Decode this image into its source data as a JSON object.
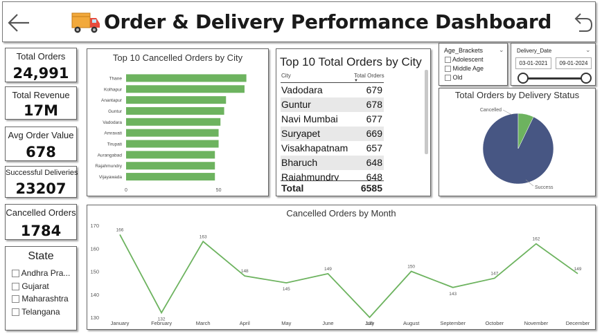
{
  "header": {
    "title": "Order & Delivery Performance  Dashboard",
    "back_icon": "arrow-left-icon",
    "truck_icon": "delivery-truck-icon",
    "reset_icon": "undo-arrow-icon"
  },
  "kpis": [
    {
      "label": "Total Orders",
      "value": "24,991"
    },
    {
      "label": "Total Revenue",
      "value": "17M"
    },
    {
      "label": "Avg Order Value",
      "value": "678"
    },
    {
      "label": "Successful Deliveries",
      "value": "23207"
    },
    {
      "label": "Cancelled Orders",
      "value": "1784"
    }
  ],
  "state_slicer": {
    "title": "State",
    "options": [
      "Andhra Pra...",
      "Gujarat",
      "Maharashtra",
      "Telangana"
    ]
  },
  "age_slicer": {
    "title": "Age_Brackets",
    "options": [
      "Adolescent",
      "Middle Age",
      "Old"
    ]
  },
  "date_slicer": {
    "title": "Delivery_Date",
    "start": "03-01-2021",
    "end": "09-01-2024"
  },
  "top_cities_table": {
    "title": "Top 10 Total Orders by City",
    "col_city": "City",
    "col_orders": "Total Orders",
    "rows": [
      {
        "city": "Vadodara",
        "orders": "679"
      },
      {
        "city": "Guntur",
        "orders": "678"
      },
      {
        "city": "Navi Mumbai",
        "orders": "677"
      },
      {
        "city": "Suryapet",
        "orders": "669"
      },
      {
        "city": "Visakhapatnam",
        "orders": "657"
      },
      {
        "city": "Bharuch",
        "orders": "648"
      },
      {
        "city": "Rajahmundry",
        "orders": "648"
      }
    ],
    "total_label": "Total",
    "total_value": "6585"
  },
  "colors": {
    "bar_green": "#6db35f",
    "pie_navy": "#475683",
    "pie_green": "#6db35f",
    "line_green": "#6db35f"
  },
  "chart_data": [
    {
      "type": "bar",
      "title": "Top 10 Cancelled Orders by City",
      "orientation": "horizontal",
      "categories": [
        "Thane",
        "Kolhapur",
        "Anantapur",
        "Guntur",
        "Vadodara",
        "Amravati",
        "Tirupati",
        "Aurangabad",
        "Rajahmundry",
        "Vijayawada"
      ],
      "values": [
        65,
        64,
        54,
        53,
        51,
        50,
        50,
        48,
        48,
        48
      ],
      "xticks": [
        "0",
        "50"
      ],
      "xlim": [
        0,
        70
      ]
    },
    {
      "type": "pie",
      "title": "Total Orders by Delivery Status",
      "labels": [
        "Success",
        "Cancelled"
      ],
      "values": [
        23207,
        1784
      ]
    },
    {
      "type": "line",
      "title": "Cancelled Orders by Month",
      "x": [
        "January",
        "February",
        "March",
        "April",
        "May",
        "June",
        "July",
        "August",
        "September",
        "October",
        "November",
        "December"
      ],
      "values": [
        166,
        132,
        163,
        148,
        145,
        149,
        130,
        150,
        143,
        147,
        162,
        149
      ],
      "yticks": [
        "130",
        "140",
        "150",
        "160",
        "170"
      ],
      "ylim": [
        130,
        170
      ]
    }
  ]
}
